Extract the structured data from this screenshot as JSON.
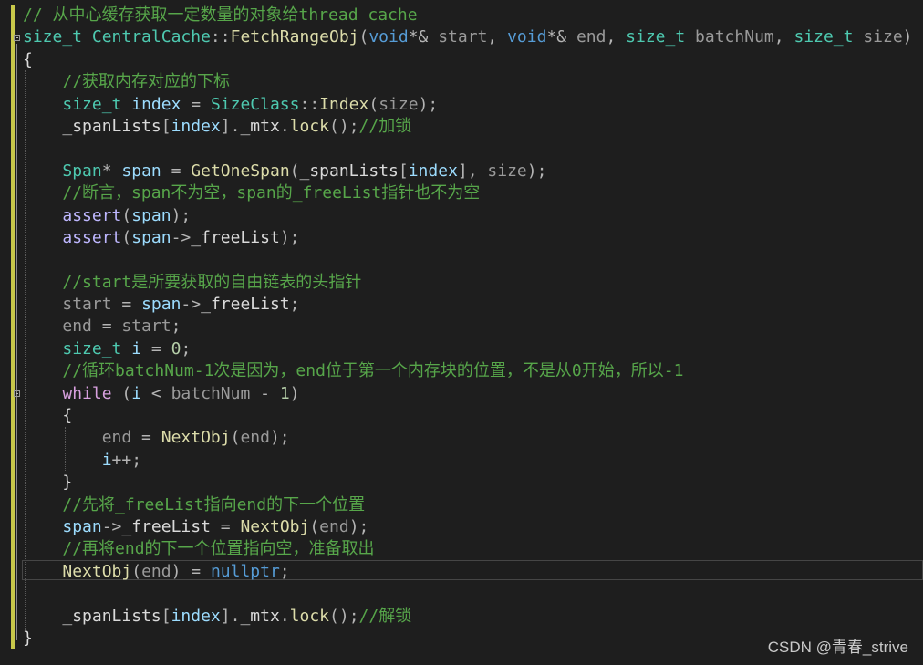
{
  "editor": {
    "colors": {
      "background": "#1e1e1e",
      "change_bar": "#c8c84a",
      "comment": "#57a64a",
      "type": "#4ec9b0",
      "keyword": "#569cd6",
      "control": "#d8a0df",
      "function": "#dcdcaa",
      "local": "#9cdcfe",
      "number": "#b5cea8",
      "text": "#dcdcdc"
    },
    "fold_icons": [
      "fold-collapse-icon",
      "fold-collapse-icon"
    ],
    "lines": [
      [
        {
          "t": "// 从中心缓存获取一定数量的对象给thread cache",
          "c": "comment"
        }
      ],
      [
        {
          "t": "size_t",
          "c": "type"
        },
        {
          "t": " ",
          "c": "plain"
        },
        {
          "t": "CentralCache",
          "c": "type"
        },
        {
          "t": "::",
          "c": "op"
        },
        {
          "t": "FetchRangeObj",
          "c": "func"
        },
        {
          "t": "(",
          "c": "punct"
        },
        {
          "t": "void",
          "c": "keyword"
        },
        {
          "t": "*& ",
          "c": "op"
        },
        {
          "t": "start",
          "c": "param"
        },
        {
          "t": ", ",
          "c": "punct"
        },
        {
          "t": "void",
          "c": "keyword"
        },
        {
          "t": "*& ",
          "c": "op"
        },
        {
          "t": "end",
          "c": "param"
        },
        {
          "t": ", ",
          "c": "punct"
        },
        {
          "t": "size_t",
          "c": "type"
        },
        {
          "t": " ",
          "c": "plain"
        },
        {
          "t": "batchNum",
          "c": "param"
        },
        {
          "t": ", ",
          "c": "punct"
        },
        {
          "t": "size_t",
          "c": "type"
        },
        {
          "t": " ",
          "c": "plain"
        },
        {
          "t": "size",
          "c": "param"
        },
        {
          "t": ")",
          "c": "punct"
        }
      ],
      [
        {
          "t": "{",
          "c": "plain"
        }
      ],
      [
        {
          "t": "    ",
          "c": "plain"
        },
        {
          "t": "//获取内存对应的下标",
          "c": "comment"
        }
      ],
      [
        {
          "t": "    ",
          "c": "plain"
        },
        {
          "t": "size_t",
          "c": "type"
        },
        {
          "t": " ",
          "c": "plain"
        },
        {
          "t": "index",
          "c": "local"
        },
        {
          "t": " = ",
          "c": "op"
        },
        {
          "t": "SizeClass",
          "c": "type"
        },
        {
          "t": "::",
          "c": "op"
        },
        {
          "t": "Index",
          "c": "func"
        },
        {
          "t": "(",
          "c": "punct"
        },
        {
          "t": "size",
          "c": "param"
        },
        {
          "t": ");",
          "c": "punct"
        }
      ],
      [
        {
          "t": "    ",
          "c": "plain"
        },
        {
          "t": "_spanLists",
          "c": "member"
        },
        {
          "t": "[",
          "c": "punct"
        },
        {
          "t": "index",
          "c": "local"
        },
        {
          "t": "].",
          "c": "punct"
        },
        {
          "t": "_mtx",
          "c": "member"
        },
        {
          "t": ".",
          "c": "punct"
        },
        {
          "t": "lock",
          "c": "func"
        },
        {
          "t": "();",
          "c": "punct"
        },
        {
          "t": "//加锁",
          "c": "comment"
        }
      ],
      [
        {
          "t": "",
          "c": "plain"
        }
      ],
      [
        {
          "t": "    ",
          "c": "plain"
        },
        {
          "t": "Span",
          "c": "type"
        },
        {
          "t": "* ",
          "c": "op"
        },
        {
          "t": "span",
          "c": "local"
        },
        {
          "t": " = ",
          "c": "op"
        },
        {
          "t": "GetOneSpan",
          "c": "func"
        },
        {
          "t": "(",
          "c": "punct"
        },
        {
          "t": "_spanLists",
          "c": "member"
        },
        {
          "t": "[",
          "c": "punct"
        },
        {
          "t": "index",
          "c": "local"
        },
        {
          "t": "], ",
          "c": "punct"
        },
        {
          "t": "size",
          "c": "param"
        },
        {
          "t": ");",
          "c": "punct"
        }
      ],
      [
        {
          "t": "    ",
          "c": "plain"
        },
        {
          "t": "//断言，span不为空，span的_freeList指针也不为空",
          "c": "comment"
        }
      ],
      [
        {
          "t": "    ",
          "c": "plain"
        },
        {
          "t": "assert",
          "c": "macro"
        },
        {
          "t": "(",
          "c": "punct"
        },
        {
          "t": "span",
          "c": "local"
        },
        {
          "t": ");",
          "c": "punct"
        }
      ],
      [
        {
          "t": "    ",
          "c": "plain"
        },
        {
          "t": "assert",
          "c": "macro"
        },
        {
          "t": "(",
          "c": "punct"
        },
        {
          "t": "span",
          "c": "local"
        },
        {
          "t": "->",
          "c": "op"
        },
        {
          "t": "_freeList",
          "c": "member"
        },
        {
          "t": ");",
          "c": "punct"
        }
      ],
      [
        {
          "t": "",
          "c": "plain"
        }
      ],
      [
        {
          "t": "    ",
          "c": "plain"
        },
        {
          "t": "//start是所要获取的自由链表的头指针",
          "c": "comment"
        }
      ],
      [
        {
          "t": "    ",
          "c": "plain"
        },
        {
          "t": "start",
          "c": "param"
        },
        {
          "t": " = ",
          "c": "op"
        },
        {
          "t": "span",
          "c": "local"
        },
        {
          "t": "->",
          "c": "op"
        },
        {
          "t": "_freeList",
          "c": "member"
        },
        {
          "t": ";",
          "c": "punct"
        }
      ],
      [
        {
          "t": "    ",
          "c": "plain"
        },
        {
          "t": "end",
          "c": "param"
        },
        {
          "t": " = ",
          "c": "op"
        },
        {
          "t": "start",
          "c": "param"
        },
        {
          "t": ";",
          "c": "punct"
        }
      ],
      [
        {
          "t": "    ",
          "c": "plain"
        },
        {
          "t": "size_t",
          "c": "type"
        },
        {
          "t": " ",
          "c": "plain"
        },
        {
          "t": "i",
          "c": "local"
        },
        {
          "t": " = ",
          "c": "op"
        },
        {
          "t": "0",
          "c": "number"
        },
        {
          "t": ";",
          "c": "punct"
        }
      ],
      [
        {
          "t": "    ",
          "c": "plain"
        },
        {
          "t": "//循环batchNum-1次是因为，end位于第一个内存块的位置，不是从0开始，所以-1",
          "c": "comment"
        }
      ],
      [
        {
          "t": "    ",
          "c": "plain"
        },
        {
          "t": "while",
          "c": "control"
        },
        {
          "t": " (",
          "c": "punct"
        },
        {
          "t": "i",
          "c": "local"
        },
        {
          "t": " < ",
          "c": "op"
        },
        {
          "t": "batchNum",
          "c": "param"
        },
        {
          "t": " - ",
          "c": "op"
        },
        {
          "t": "1",
          "c": "number"
        },
        {
          "t": ")",
          "c": "punct"
        }
      ],
      [
        {
          "t": "    ",
          "c": "plain"
        },
        {
          "t": "{",
          "c": "plain"
        }
      ],
      [
        {
          "t": "        ",
          "c": "plain"
        },
        {
          "t": "end",
          "c": "param"
        },
        {
          "t": " = ",
          "c": "op"
        },
        {
          "t": "NextObj",
          "c": "func"
        },
        {
          "t": "(",
          "c": "punct"
        },
        {
          "t": "end",
          "c": "param"
        },
        {
          "t": ");",
          "c": "punct"
        }
      ],
      [
        {
          "t": "        ",
          "c": "plain"
        },
        {
          "t": "i",
          "c": "local"
        },
        {
          "t": "++;",
          "c": "op"
        }
      ],
      [
        {
          "t": "    ",
          "c": "plain"
        },
        {
          "t": "}",
          "c": "plain"
        }
      ],
      [
        {
          "t": "    ",
          "c": "plain"
        },
        {
          "t": "//先将_freeList指向end的下一个位置",
          "c": "comment"
        }
      ],
      [
        {
          "t": "    ",
          "c": "plain"
        },
        {
          "t": "span",
          "c": "local"
        },
        {
          "t": "->",
          "c": "op"
        },
        {
          "t": "_freeList",
          "c": "member"
        },
        {
          "t": " = ",
          "c": "op"
        },
        {
          "t": "NextObj",
          "c": "func"
        },
        {
          "t": "(",
          "c": "punct"
        },
        {
          "t": "end",
          "c": "param"
        },
        {
          "t": ");",
          "c": "punct"
        }
      ],
      [
        {
          "t": "    ",
          "c": "plain"
        },
        {
          "t": "//再将end的下一个位置指向空，准备取出",
          "c": "comment"
        }
      ],
      [
        {
          "t": "    ",
          "c": "plain"
        },
        {
          "t": "NextObj",
          "c": "func"
        },
        {
          "t": "(",
          "c": "punct"
        },
        {
          "t": "end",
          "c": "param"
        },
        {
          "t": ") = ",
          "c": "op"
        },
        {
          "t": "nullptr",
          "c": "keyword"
        },
        {
          "t": ";",
          "c": "punct"
        }
      ],
      [
        {
          "t": "",
          "c": "plain"
        }
      ],
      [
        {
          "t": "    ",
          "c": "plain"
        },
        {
          "t": "_spanLists",
          "c": "member"
        },
        {
          "t": "[",
          "c": "punct"
        },
        {
          "t": "index",
          "c": "local"
        },
        {
          "t": "].",
          "c": "punct"
        },
        {
          "t": "_mtx",
          "c": "member"
        },
        {
          "t": ".",
          "c": "punct"
        },
        {
          "t": "lock",
          "c": "func"
        },
        {
          "t": "();",
          "c": "punct"
        },
        {
          "t": "//解锁",
          "c": "comment"
        }
      ],
      [
        {
          "t": "}",
          "c": "plain"
        }
      ]
    ]
  },
  "watermark": "CSDN @青春_strive"
}
